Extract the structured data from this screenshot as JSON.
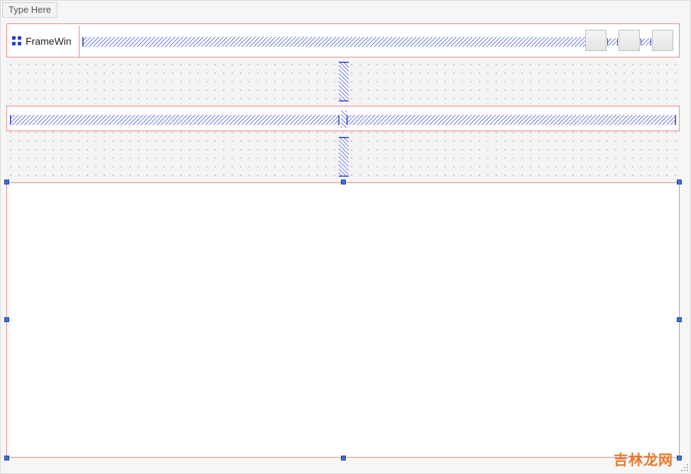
{
  "menubar": {
    "placeholder": "Type Here"
  },
  "toolbar": {
    "label": "FrameWin",
    "icon": "grid-icon"
  },
  "spacers": {
    "toolbar_main": "horizontal-spacer",
    "toolbar_mini_1": "horizontal-spacer",
    "toolbar_mini_2": "horizontal-spacer",
    "vertical_1": "vertical-spacer",
    "vertical_2": "vertical-spacer",
    "listview_left": "horizontal-spacer",
    "listview_right": "horizontal-spacer"
  },
  "watermark": "吉林龙网"
}
